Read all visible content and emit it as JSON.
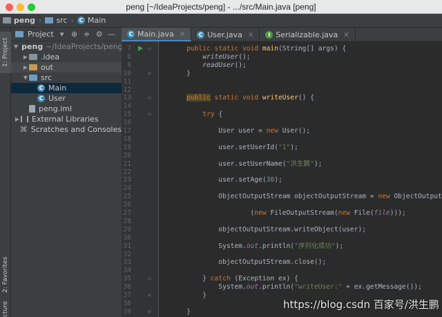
{
  "window": {
    "title": "peng [~/IdeaProjects/peng] - .../src/Main.java [peng]"
  },
  "breadcrumb": {
    "project": "peng",
    "folder": "src",
    "file": "Main"
  },
  "side_tabs": {
    "project": "1: Project",
    "favorites": "2: Favorites",
    "structure": "cture"
  },
  "project_panel": {
    "view_selector": "Project",
    "tree": [
      {
        "label": "peng",
        "hint": "~/IdeaProjects/peng",
        "icon": "folder-icon",
        "indent": 0,
        "expanded": true
      },
      {
        "label": ".idea",
        "icon": "folder-icon",
        "indent": 1,
        "expanded": false
      },
      {
        "label": "out",
        "icon": "folder-orange-icon",
        "indent": 1,
        "expanded": false
      },
      {
        "label": "src",
        "icon": "folder-blue-icon",
        "indent": 1,
        "expanded": true
      },
      {
        "label": "Main",
        "icon": "class-icon",
        "indent": 2
      },
      {
        "label": "User",
        "icon": "class-icon",
        "indent": 2
      },
      {
        "label": "peng.iml",
        "icon": "file-icon",
        "indent": 1
      },
      {
        "label": "External Libraries",
        "icon": "library-icon",
        "indent": 0,
        "expanded": false
      },
      {
        "label": "Scratches and Consoles",
        "icon": "scratch-icon",
        "indent": 0
      }
    ]
  },
  "tabs": [
    {
      "label": "Main.java",
      "icon": "class-icon",
      "active": true
    },
    {
      "label": "User.java",
      "icon": "class-icon",
      "active": false
    },
    {
      "label": "Serializable.java",
      "icon": "interface-icon",
      "active": false
    }
  ],
  "editor": {
    "lines": [
      {
        "n": "7",
        "run": true,
        "fold": "⊖",
        "html": "    <span class='kw'>public static void</span> <span class='fn'>main</span>(String[] args) {"
      },
      {
        "n": "8",
        "html": "        <span class='it'>writeUser</span>();"
      },
      {
        "n": "9",
        "html": "        <span class='it'>readUser</span>();"
      },
      {
        "n": "10",
        "fold": "⊕",
        "html": "    }"
      },
      {
        "n": "11",
        "html": ""
      },
      {
        "n": "12",
        "html": ""
      },
      {
        "n": "13",
        "fold": "⊖",
        "html": "    <span class='kwbox'>public</span> <span class='kw'>static void</span> <span class='fn'>writeUser</span>() {"
      },
      {
        "n": "14",
        "html": ""
      },
      {
        "n": "15",
        "fold": "⊖",
        "html": "        <span class='kw'>try</span> {"
      },
      {
        "n": "16",
        "html": ""
      },
      {
        "n": "17",
        "html": "            User user = <span class='kw'>new</span> User();"
      },
      {
        "n": "18",
        "html": ""
      },
      {
        "n": "19",
        "html": "            user.setUserId(<span class='str'>\"1\"</span>);"
      },
      {
        "n": "20",
        "html": ""
      },
      {
        "n": "21",
        "html": "            user.setUserName(<span class='str'>\"洪生鹏\"</span>);"
      },
      {
        "n": "22",
        "html": ""
      },
      {
        "n": "23",
        "html": "            user.setAge(<span class='num'>30</span>);"
      },
      {
        "n": "24",
        "html": ""
      },
      {
        "n": "25",
        "html": "            ObjectOutputStream objectOutputStream = <span class='kw'>new</span> ObjectOutputStream"
      },
      {
        "n": "26",
        "html": ""
      },
      {
        "n": "27",
        "html": "                    (<span class='kw'>new</span> FileOutputStream(<span class='kw'>new</span> File(<span class='fld'>file</span>)));"
      },
      {
        "n": "28",
        "html": ""
      },
      {
        "n": "29",
        "html": "            objectOutputStream.writeObject(user);"
      },
      {
        "n": "30",
        "html": ""
      },
      {
        "n": "31",
        "html": "            System.<span class='fld'>out</span>.println(<span class='str'>\"序列化成功\"</span>);"
      },
      {
        "n": "32",
        "html": ""
      },
      {
        "n": "33",
        "html": "            objectOutputStream.close();"
      },
      {
        "n": "34",
        "html": ""
      },
      {
        "n": "35",
        "fold": "⊖",
        "html": "        } <span class='kw'>catch</span> (Exception ex) {"
      },
      {
        "n": "36",
        "html": "            System.<span class='fld'>out</span>.println(<span class='str'>\"writeUser:\"</span> + ex.getMessage());"
      },
      {
        "n": "37",
        "fold": "⊕",
        "html": "        }"
      },
      {
        "n": "38",
        "html": ""
      },
      {
        "n": "39",
        "fold": "⊕",
        "html": "    }"
      }
    ]
  },
  "watermark": "https://blog.csdn 百家号/洪生鹏"
}
